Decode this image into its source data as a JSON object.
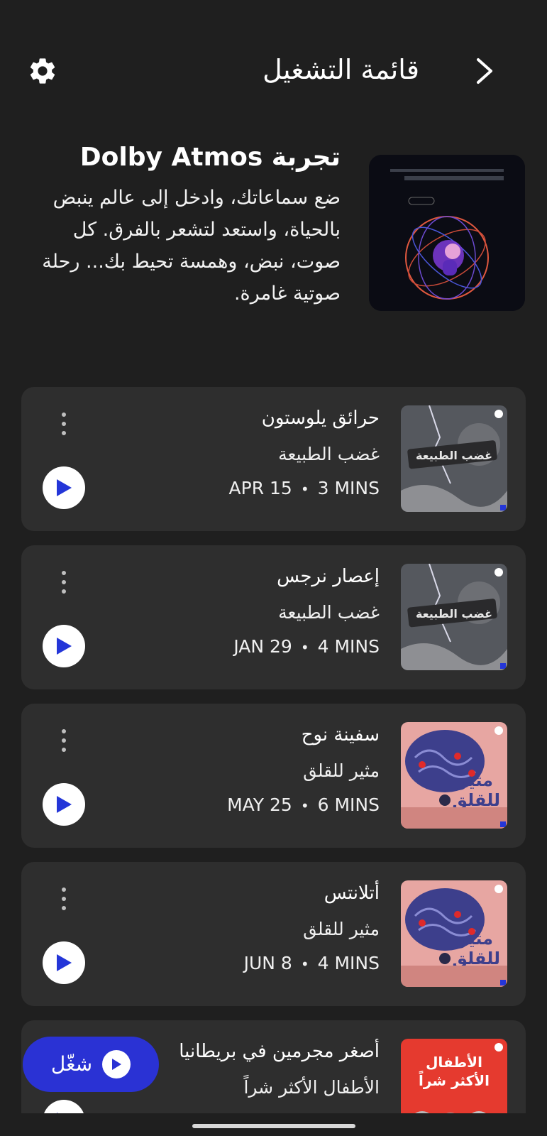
{
  "header": {
    "title": "قائمة التشغيل",
    "settings_icon": "gear-icon",
    "back_icon": "chevron-right-icon"
  },
  "promo": {
    "title": "تجربة Dolby Atmos",
    "body": "ضع سماعاتك، وادخل إلى عالم ينبض بالحياة، واستعد لتشعر بالفرق. كل صوت، نبض، وهمسة تحيط بك... رحلة صوتية غامرة."
  },
  "episodes": [
    {
      "title": "حرائق يلوستون",
      "show": "غضب الطبيعة",
      "date": "APR 15",
      "duration": "3 MINS",
      "thumb_color": "#5a5f66",
      "thumb_text": "غضب الطبيعة"
    },
    {
      "title": "إعصار نرجس",
      "show": "غضب الطبيعة",
      "date": "JAN 29",
      "duration": "4 MINS",
      "thumb_color": "#5a5f66",
      "thumb_text": "غضب الطبيعة"
    },
    {
      "title": "سفينة نوح",
      "show": "مثير للقلق",
      "date": "MAY 25",
      "duration": "6 MINS",
      "thumb_color": "#e7a6a2",
      "thumb_text": "مثير للقلق"
    },
    {
      "title": "أتلانتس",
      "show": "مثير للقلق",
      "date": "JUN 8",
      "duration": "4 MINS",
      "thumb_color": "#e7a6a2",
      "thumb_text": "مثير للقلق"
    },
    {
      "title": "أصغر مجرمين في بريطانيا",
      "show": "الأطفال الأكثر شراً",
      "date": "",
      "duration": "",
      "thumb_color": "#e53a2f",
      "thumb_text": "الأطفال الأكثر شراً"
    }
  ],
  "fab": {
    "label": "شغّل"
  },
  "colors": {
    "background": "#1f1f1f",
    "card": "#2e2e2e",
    "accent": "#2a32d4",
    "play_icon": "#2436d8"
  }
}
